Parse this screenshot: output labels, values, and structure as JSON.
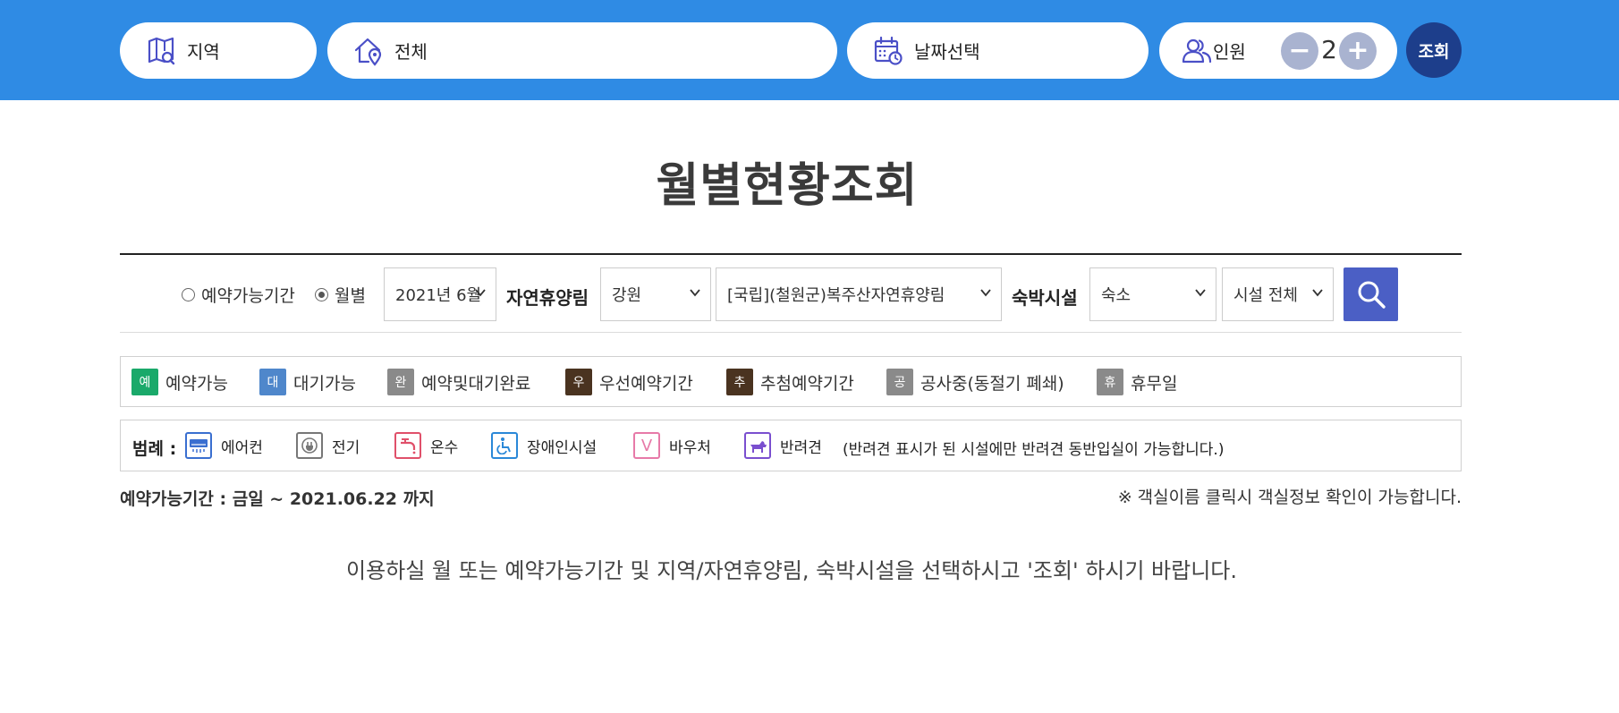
{
  "search_bar": {
    "region_label": "지역",
    "all_label": "전체",
    "date_label": "날짜선택",
    "people_label": "인원",
    "people_count": "2",
    "minus": "−",
    "plus": "+",
    "query_label": "조회"
  },
  "page": {
    "title": "월별현황조회"
  },
  "filters": {
    "radio_period": "예약가능기간",
    "radio_month": "월별",
    "selected_radio": "월별",
    "month_select": "2021년 6월",
    "forest_label": "자연휴양림",
    "province_select": "강원",
    "forest_select": "[국립](철원군)복주산자연휴양림",
    "lodging_label": "숙박시설",
    "type_select": "숙소",
    "facility_select": "시설 전체"
  },
  "status_legend": [
    {
      "badge": "예",
      "label": "예약가능",
      "color": "#1aa96a"
    },
    {
      "badge": "대",
      "label": "대기가능",
      "color": "#4f87cb"
    },
    {
      "badge": "완",
      "label": "예약및대기완료",
      "color": "#8a8a8a"
    },
    {
      "badge": "우",
      "label": "우선예약기간",
      "color": "#4a3320"
    },
    {
      "badge": "추",
      "label": "추첨예약기간",
      "color": "#4a3320"
    },
    {
      "badge": "공",
      "label": "공사중(동절기 폐쇄)",
      "color": "#8a8a8a"
    },
    {
      "badge": "휴",
      "label": "휴무일",
      "color": "#8a8a8a"
    }
  ],
  "amenity_legend": {
    "title": "범례 :",
    "items": [
      {
        "icon": "air-conditioner-icon",
        "label": "에어컨",
        "color": "#3a6fd0"
      },
      {
        "icon": "electric-plug-icon",
        "label": "전기",
        "color": "#777777"
      },
      {
        "icon": "hot-water-faucet-icon",
        "label": "온수",
        "color": "#e0506a"
      },
      {
        "icon": "wheelchair-icon",
        "label": "장애인시설",
        "color": "#2a88d8"
      },
      {
        "icon": "voucher-v-icon",
        "label": "바우처",
        "color": "#e77aa8"
      },
      {
        "icon": "dog-icon",
        "label": "반려견",
        "color": "#7a4fcf"
      }
    ],
    "pet_note": "(반려견 표시가 된 시설에만 반려견 동반입실이 가능합니다.)"
  },
  "info": {
    "period_text": "예약가능기간 : 금일 ~ 2021.06.22 까지",
    "room_hint": "※ 객실이름 클릭시 객실정보 확인이 가능합니다.",
    "guide_text": "이용하실 월 또는 예약가능기간 및 지역/자연휴양림, 숙박시설을 선택하시고 '조회' 하시기 바랍니다."
  },
  "colors": {
    "header_bg": "#2f8be4",
    "query_button": "#1d3e8b",
    "search_button": "#4b5fc5",
    "stepper": "#a9b3d0",
    "icon_accent": "#4a4fc7"
  }
}
